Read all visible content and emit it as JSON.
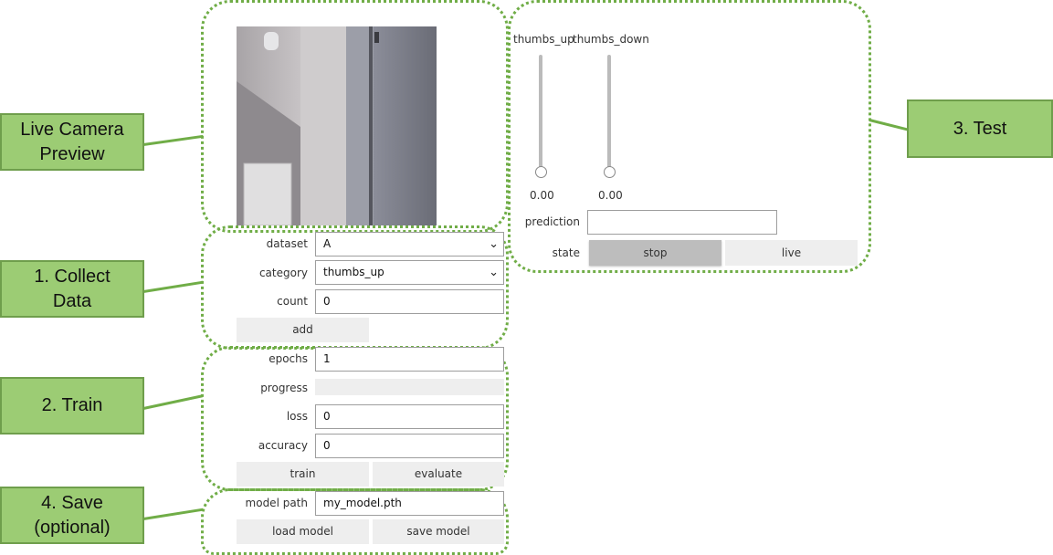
{
  "callouts": {
    "live": "Live Camera Preview",
    "collect": "1. Collect Data",
    "train": "2. Train",
    "save": "4. Save (optional)",
    "test": "3. Test"
  },
  "colors": {
    "callout_fill": "#9ccc74",
    "dotted": "#70ad47",
    "slider": "#bbbbbb"
  },
  "collect": {
    "dataset_label": "dataset",
    "dataset_value": "A",
    "category_label": "category",
    "category_value": "thumbs_up",
    "count_label": "count",
    "count_value": "0",
    "add_label": "add",
    "chevron": "chevron-down-icon"
  },
  "train": {
    "epochs_label": "epochs",
    "epochs_value": "1",
    "progress_label": "progress",
    "progress_value": 0,
    "loss_label": "loss",
    "loss_value": "0",
    "accuracy_label": "accuracy",
    "accuracy_value": "0",
    "train_label": "train",
    "evaluate_label": "evaluate"
  },
  "save": {
    "model_path_label": "model path",
    "model_path_value": "my_model.pth",
    "load_label": "load model",
    "save_label": "save model"
  },
  "test": {
    "sliders": [
      {
        "name": "thumbs_up",
        "value": "0.00",
        "level": 0
      },
      {
        "name": "thumbs_down",
        "value": "0.00",
        "level": 0
      }
    ],
    "prediction_label": "prediction",
    "prediction_value": "",
    "state_label": "state",
    "stop_label": "stop",
    "live_label": "live",
    "state_selected": "stop"
  }
}
